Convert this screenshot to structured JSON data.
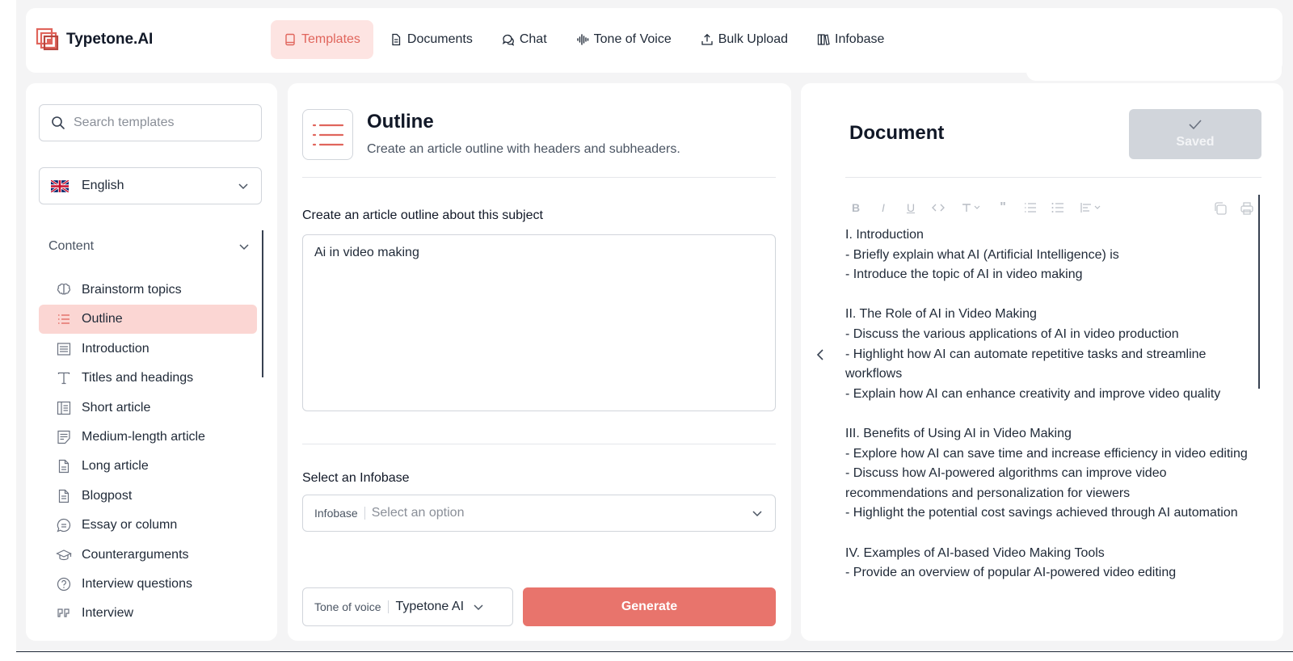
{
  "app": {
    "name": "Typetone.AI"
  },
  "nav": [
    {
      "label": "Templates",
      "icon": "book-icon",
      "active": true
    },
    {
      "label": "Documents",
      "icon": "document-icon"
    },
    {
      "label": "Chat",
      "icon": "chat-icon"
    },
    {
      "label": "Tone of Voice",
      "icon": "waveform-icon"
    },
    {
      "label": "Bulk Upload",
      "icon": "upload-icon"
    },
    {
      "label": "Infobase",
      "icon": "library-icon"
    }
  ],
  "sidebar": {
    "search_placeholder": "Search templates",
    "language": "English",
    "section": "Content",
    "templates": [
      {
        "label": "Brainstorm topics",
        "icon": "brain-icon"
      },
      {
        "label": "Outline",
        "icon": "list-icon",
        "active": true
      },
      {
        "label": "Introduction",
        "icon": "paragraph-icon"
      },
      {
        "label": "Titles and headings",
        "icon": "text-type-icon"
      },
      {
        "label": "Short article",
        "icon": "article-icon"
      },
      {
        "label": "Medium-length article",
        "icon": "article-edit-icon"
      },
      {
        "label": "Long article",
        "icon": "file-icon"
      },
      {
        "label": "Blogpost",
        "icon": "file-text-icon"
      },
      {
        "label": "Essay or column",
        "icon": "message-circle-icon"
      },
      {
        "label": "Counterarguments",
        "icon": "graduation-cap-icon"
      },
      {
        "label": "Interview questions",
        "icon": "question-circle-icon"
      },
      {
        "label": "Interview",
        "icon": "quote-icon"
      }
    ]
  },
  "template": {
    "title": "Outline",
    "description": "Create an article outline with headers and subheaders.",
    "subject_label": "Create an article outline about this subject",
    "subject_value": "Ai in video making",
    "infobase_label": "Select an Infobase",
    "infobase_prefix": "Infobase",
    "infobase_placeholder": "Select an option",
    "tone_prefix": "Tone of voice",
    "tone_value": "Typetone AI",
    "generate_label": "Generate"
  },
  "document": {
    "title": "Document",
    "saved_label": "Saved",
    "lines": [
      "I. Introduction",
      "- Briefly explain what AI (Artificial Intelligence) is",
      "- Introduce the topic of AI in video making",
      "",
      "II. The Role of AI in Video Making",
      "- Discuss the various applications of AI in video production",
      "- Highlight how AI can automate repetitive tasks and streamline workflows",
      "- Explain how AI can enhance creativity and improve video quality",
      "",
      "III. Benefits of Using AI in Video Making",
      "- Explore how AI can save time and increase efficiency in video editing",
      "- Discuss how AI-powered algorithms can improve video recommendations and personalization for viewers",
      "- Highlight the potential cost savings achieved through AI automation",
      "",
      "IV. Examples of AI-based Video Making Tools",
      "- Provide an overview of popular AI-powered video editing"
    ]
  },
  "colors": {
    "accent": "#e8746c",
    "accent_soft": "#fde4e2",
    "active_item": "#fbd6d3"
  }
}
